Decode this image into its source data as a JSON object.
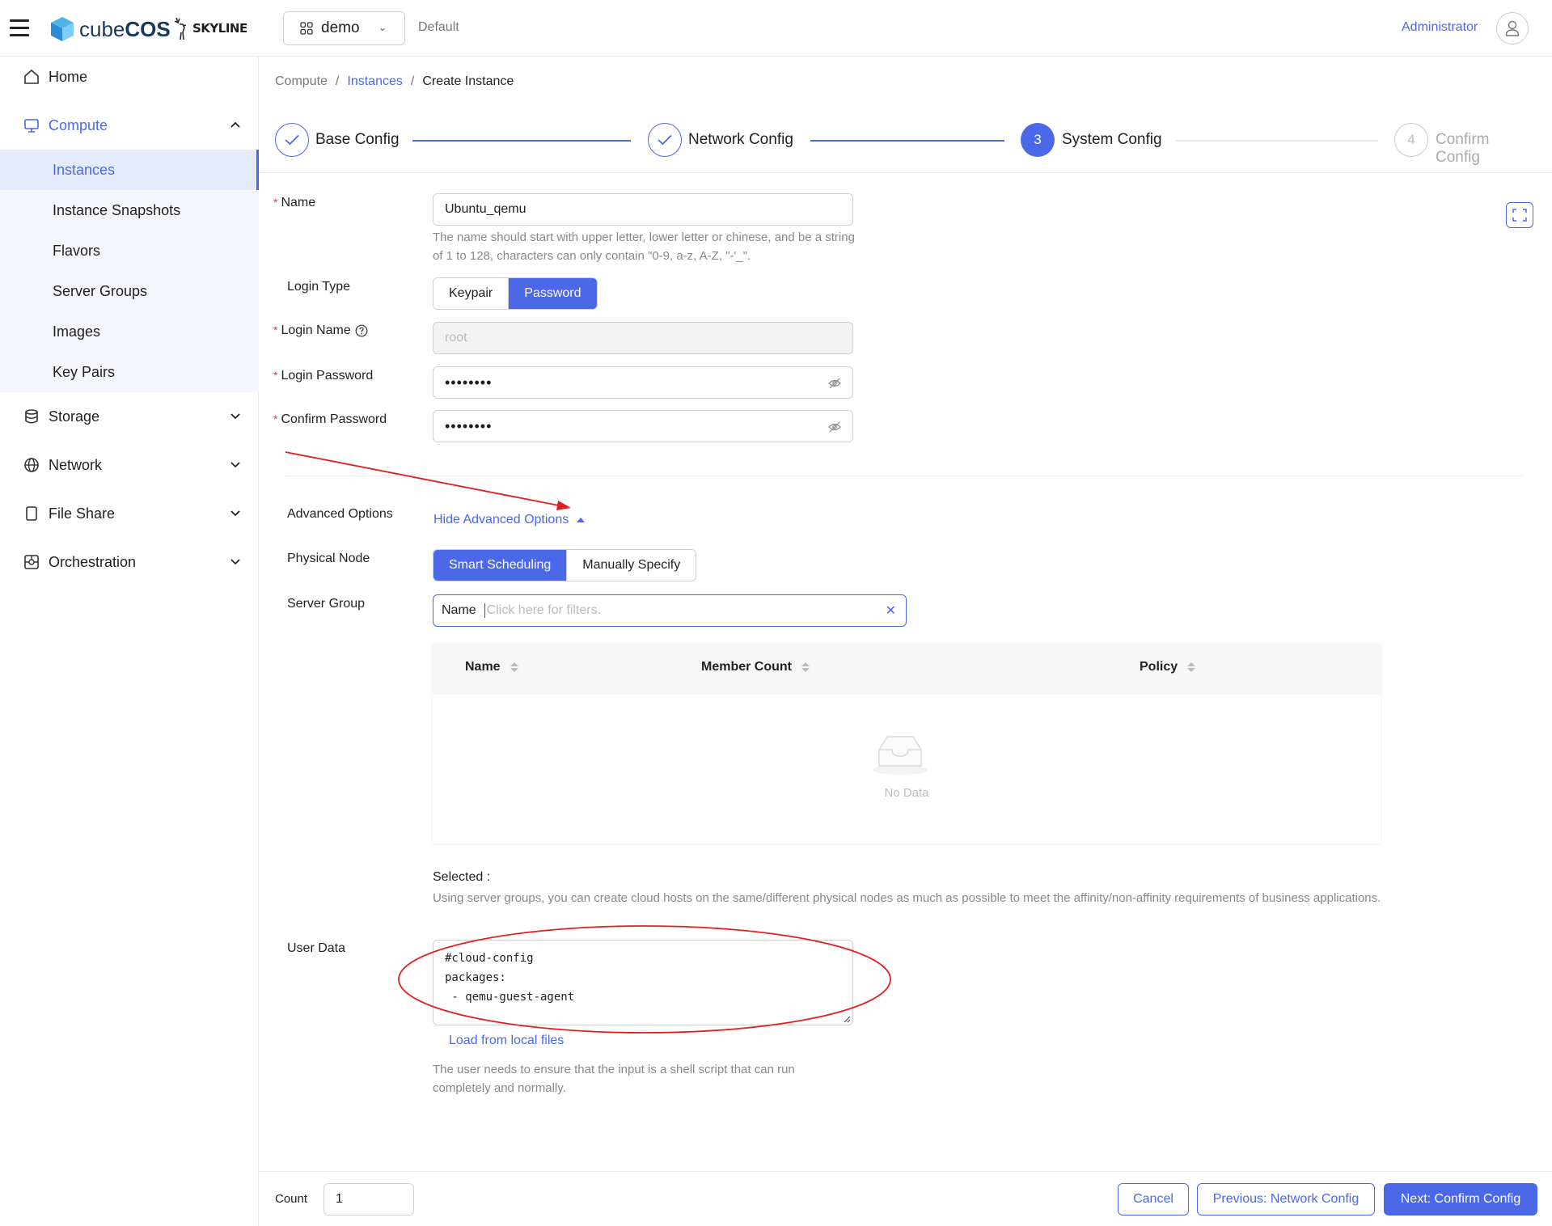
{
  "header": {
    "logo_text_light": "cube",
    "logo_text_bold": "COS",
    "skyline_text": "SKYLINE",
    "project": "demo",
    "domain": "Default",
    "user": "Administrator"
  },
  "sidebar": {
    "items": [
      {
        "label": "Home",
        "icon": "home-icon"
      },
      {
        "label": "Compute",
        "icon": "monitor-icon"
      },
      {
        "label": "Storage",
        "icon": "database-icon"
      },
      {
        "label": "Network",
        "icon": "globe-icon"
      },
      {
        "label": "File Share",
        "icon": "file-share-icon"
      },
      {
        "label": "Orchestration",
        "icon": "orchestration-icon"
      }
    ],
    "compute_sub": [
      "Instances",
      "Instance Snapshots",
      "Flavors",
      "Server Groups",
      "Images",
      "Key Pairs"
    ]
  },
  "breadcrumb": {
    "root": "Compute",
    "sep": "/",
    "link": "Instances",
    "current": "Create Instance"
  },
  "steps": [
    {
      "label": "Base Config",
      "num": "1",
      "state": "done"
    },
    {
      "label": "Network Config",
      "num": "2",
      "state": "done"
    },
    {
      "label": "System Config",
      "num": "3",
      "state": "current"
    },
    {
      "label": "Confirm Config",
      "num": "4",
      "state": "todo"
    }
  ],
  "form": {
    "name_label": "Name",
    "name_value": "Ubuntu_qemu",
    "name_hint": "The name should start with upper letter, lower letter or chinese, and be a string of 1 to 128, characters can only contain \"0-9, a-z, A-Z, \"-'_\".",
    "login_type_label": "Login Type",
    "login_type_options": [
      "Keypair",
      "Password"
    ],
    "login_name_label": "Login Name",
    "login_name_value": "root",
    "login_password_label": "Login Password",
    "login_password_value": "••••••••",
    "confirm_password_label": "Confirm Password",
    "confirm_password_value": "••••••••",
    "advanced_label": "Advanced Options",
    "advanced_link": "Hide Advanced Options",
    "physical_node_label": "Physical Node",
    "physical_node_options": [
      "Smart Scheduling",
      "Manually Specify"
    ],
    "server_group_label": "Server Group",
    "filter_tag": "Name",
    "filter_placeholder": "Click here for filters.",
    "table_headers": [
      "Name",
      "Member Count",
      "Policy"
    ],
    "table_empty": "No Data",
    "selected_label": "Selected :",
    "server_group_hint": "Using server groups, you can create cloud hosts on the same/different physical nodes as much as possible to meet the affinity/non-affinity requirements of business applications.",
    "user_data_label": "User Data",
    "user_data_value": "#cloud-config\npackages:\n - qemu-guest-agent",
    "load_files": "Load from local files",
    "user_data_hint": "The user needs to ensure that the input is a shell script that can run completely and normally."
  },
  "footer": {
    "count_label": "Count",
    "count_value": "1",
    "cancel": "Cancel",
    "previous": "Previous: Network Config",
    "next": "Next: Confirm Config"
  },
  "colors": {
    "accent": "#4a68e8",
    "annotation": "#e02020",
    "required": "#e03c3c"
  }
}
